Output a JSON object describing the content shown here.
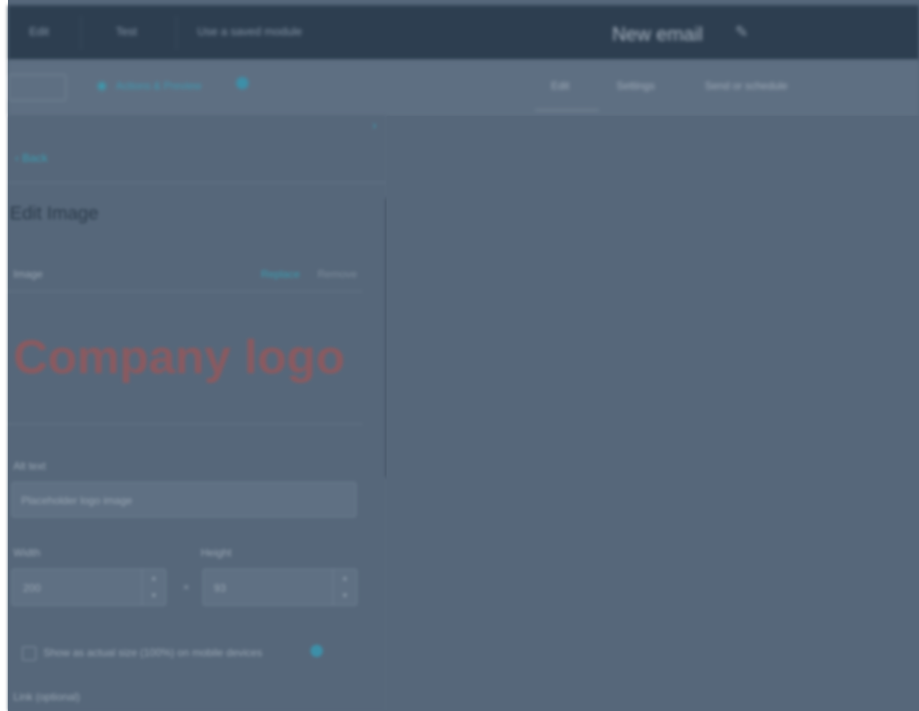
{
  "topbar": {
    "tabs": [
      "Edit",
      "Test",
      "Use a saved module"
    ],
    "email_name": "New email",
    "pencil_icon": "pencil-icon"
  },
  "subbar": {
    "preview_label": "Actions & Preview",
    "nav": [
      "Edit",
      "Settings",
      "Send or schedule"
    ],
    "icons": {
      "preview": "eye-icon",
      "help": "help-icon"
    }
  },
  "panel": {
    "back_link": "‹ Back",
    "title": "Edit Image",
    "image_label": "Image",
    "replace": "Replace",
    "remove": "Remove",
    "logo_text": "Company logo",
    "alt_label": "Alt text",
    "alt_value": "Placeholder logo image",
    "width_label": "Width",
    "width_value": "200",
    "height_label": "Height",
    "height_value": "93",
    "times": "×",
    "responsive_label": "Show as actual size (100%) on mobile devices",
    "link_label": "Link (optional)"
  },
  "colors": {
    "accent": "#3b9db1",
    "logo": "#8a5a60",
    "topbar": "#2d3e50",
    "overlay": "#56677a"
  }
}
